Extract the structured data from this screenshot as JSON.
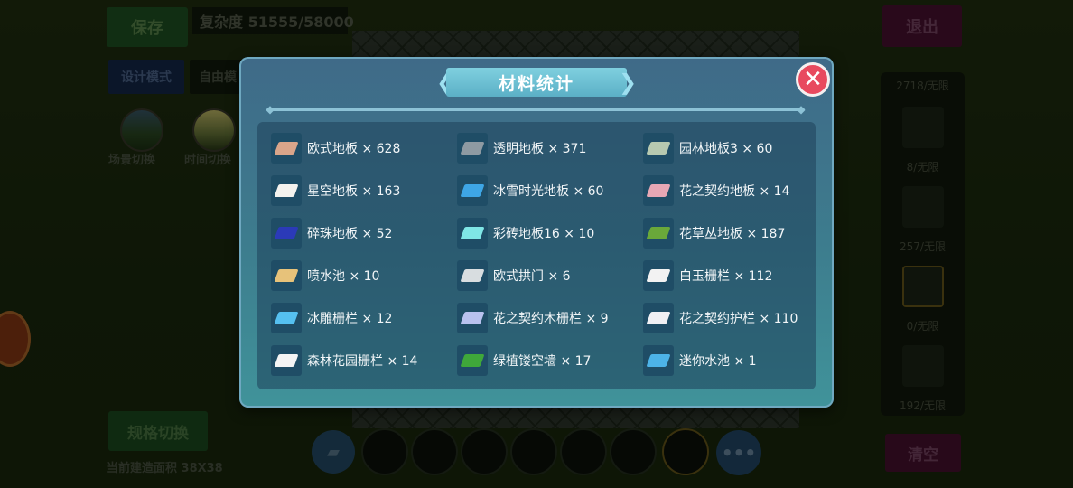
{
  "background": {
    "save_label": "保存",
    "complexity": "复杂度 51555/58000",
    "design_mode_label": "设计模式",
    "free_mode_label": "自由模",
    "scene_switch_label": "场景切换",
    "time_switch_label": "时间切换",
    "exit_label": "退出",
    "side_counts": [
      "2718/无限",
      "8/无限",
      "257/无限",
      "0/无限",
      "192/无限"
    ],
    "clear_label": "清空",
    "spec_switch_label": "规格切换",
    "area_label": "当前建造面积 38X38"
  },
  "modal": {
    "title": "材料统计",
    "close_icon": "close-x-icon",
    "items": [
      {
        "label": "欧式地板 × 628",
        "icon": "euro-floor-icon",
        "color": "#d9a58a"
      },
      {
        "label": "透明地板 × 371",
        "icon": "transparent-floor-icon",
        "color": "#8e9aa2"
      },
      {
        "label": "园林地板3 × 60",
        "icon": "garden-floor-icon",
        "color": "#b7c9b0"
      },
      {
        "label": "星空地板 × 163",
        "icon": "starry-floor-icon",
        "color": "#f4f2ee"
      },
      {
        "label": "冰雪时光地板 × 60",
        "icon": "ice-snow-floor-icon",
        "color": "#3ea6e6"
      },
      {
        "label": "花之契约地板 × 14",
        "icon": "flower-pact-floor-icon",
        "color": "#e7a7b4"
      },
      {
        "label": "碎珠地板 × 52",
        "icon": "bead-floor-icon",
        "color": "#2b3ab8"
      },
      {
        "label": "彩砖地板16 × 10",
        "icon": "color-tile-floor-icon",
        "color": "#7fe6e6"
      },
      {
        "label": "花草丛地板 × 187",
        "icon": "flower-grass-floor-icon",
        "color": "#6aa83a"
      },
      {
        "label": "喷水池 × 10",
        "icon": "fountain-icon",
        "color": "#e7c27a"
      },
      {
        "label": "欧式拱门 × 6",
        "icon": "euro-arch-icon",
        "color": "#d8dde0"
      },
      {
        "label": "白玉栅栏 × 112",
        "icon": "jade-fence-icon",
        "color": "#f2f2f2"
      },
      {
        "label": "冰雕栅栏 × 12",
        "icon": "ice-fence-icon",
        "color": "#55c0f0"
      },
      {
        "label": "花之契约木栅栏 × 9",
        "icon": "flower-wood-fence-icon",
        "color": "#b9c2ef"
      },
      {
        "label": "花之契约护栏 × 110",
        "icon": "flower-rail-icon",
        "color": "#f0f0f4"
      },
      {
        "label": "森林花园栅栏 × 14",
        "icon": "forest-fence-icon",
        "color": "#f4f4f4"
      },
      {
        "label": "绿植镂空墙 × 17",
        "icon": "green-wall-icon",
        "color": "#3fa83a"
      },
      {
        "label": "迷你水池 × 1",
        "icon": "mini-pool-icon",
        "color": "#4db3e8"
      }
    ]
  }
}
